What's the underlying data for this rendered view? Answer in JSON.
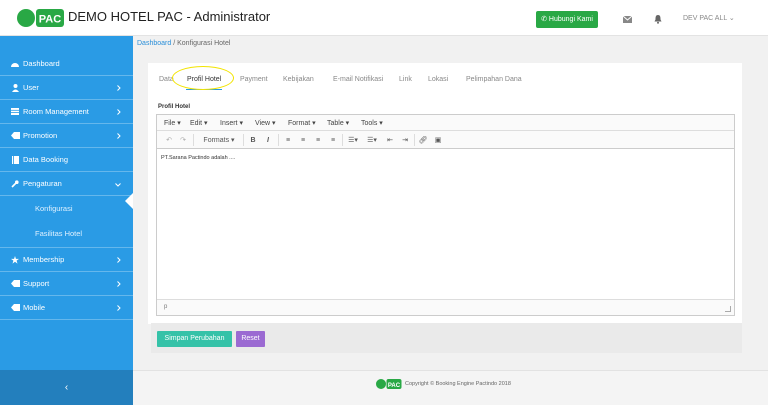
{
  "app": {
    "title": "DEMO HOTEL PAC - Administrator",
    "logo_text": "PAC"
  },
  "topbar": {
    "hubungi_label": "Hubungi Kami",
    "user_label": "DEV PAC ALL"
  },
  "sidebar": {
    "items": [
      {
        "label": "Dashboard",
        "icon": "dashboard-icon"
      },
      {
        "label": "User",
        "icon": "user-icon"
      },
      {
        "label": "Room Management",
        "icon": "room-icon"
      },
      {
        "label": "Promotion",
        "icon": "promotion-icon"
      },
      {
        "label": "Data Booking",
        "icon": "booking-icon"
      },
      {
        "label": "Pengaturan",
        "icon": "settings-icon"
      },
      {
        "label": "Konfigurasi"
      },
      {
        "label": "Fasilitas Hotel"
      },
      {
        "label": "Membership",
        "icon": "star-icon"
      },
      {
        "label": "Support",
        "icon": "support-icon"
      },
      {
        "label": "Mobile",
        "icon": "mobile-icon"
      }
    ],
    "collapse_glyph": "‹"
  },
  "breadcrumb": {
    "root": "Dashboard",
    "separator": "/",
    "current": "Konfigurasi Hotel"
  },
  "tabs": [
    "Data",
    "Profil Hotel",
    "Payment",
    "Kebijakan",
    "E-mail Notifikasi",
    "Link",
    "Lokasi",
    "Pelimpahan Dana"
  ],
  "form": {
    "field_label": "Profil Hotel"
  },
  "editor": {
    "menus": [
      "File",
      "Edit",
      "Insert",
      "View",
      "Format",
      "Table",
      "Tools"
    ],
    "formats_label": "Formats",
    "content": "PT.Sarana Pactindo adalah ....",
    "status_path": "p"
  },
  "actions": {
    "save_label": "Simpan Perubahan",
    "reset_label": "Reset"
  },
  "footer": {
    "copyright": "Copyright © Booking Engine Pactindo 2018"
  },
  "colors": {
    "sidebar": "#2a9be5",
    "hubungi": "#29a845",
    "save": "#35c2a8",
    "reset": "#9b6ad2",
    "logo": "#29a845"
  }
}
